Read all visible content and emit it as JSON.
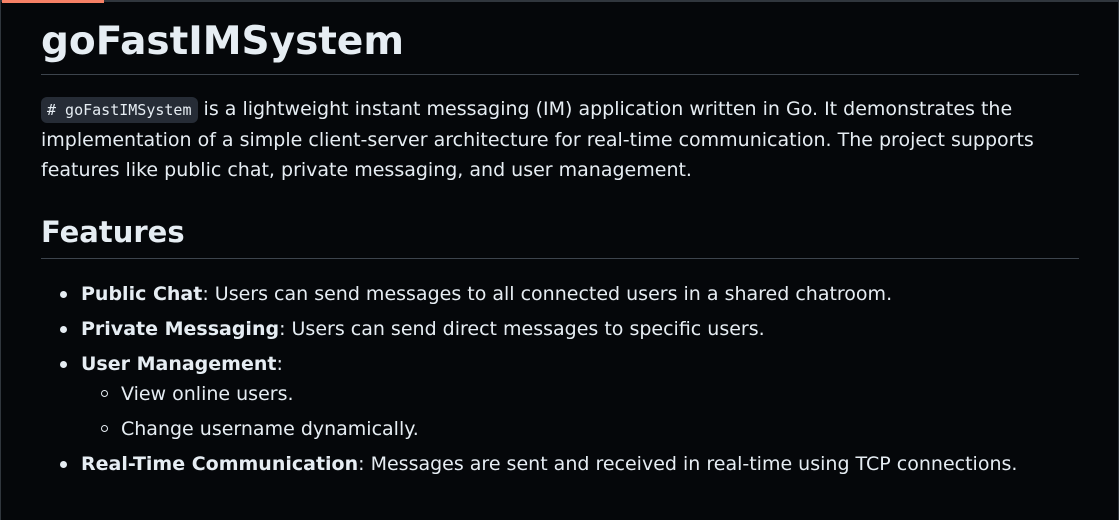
{
  "readme": {
    "title": "goFastIMSystem",
    "intro": {
      "code": "# goFastIMSystem",
      "text": " is a lightweight instant messaging (IM) application written in Go. It demonstrates the implementation of a simple client-server architecture for real-time communication. The project supports features like public chat, private messaging, and user management."
    },
    "features_heading": "Features",
    "features": [
      {
        "name": "Public Chat",
        "desc": ": Users can send messages to all connected users in a shared chatroom."
      },
      {
        "name": "Private Messaging",
        "desc": ": Users can send direct messages to specific users."
      },
      {
        "name": "User Management",
        "desc": ":",
        "sub": [
          "View online users.",
          "Change username dynamically."
        ]
      },
      {
        "name": "Real-Time Communication",
        "desc": ": Messages are sent and received in real-time using TCP connections."
      }
    ]
  },
  "colors": {
    "background": "#05070a",
    "text": "#e6edf3",
    "code_bg": "#262c36",
    "divider": "#3d444d",
    "accent": "#f78166"
  }
}
